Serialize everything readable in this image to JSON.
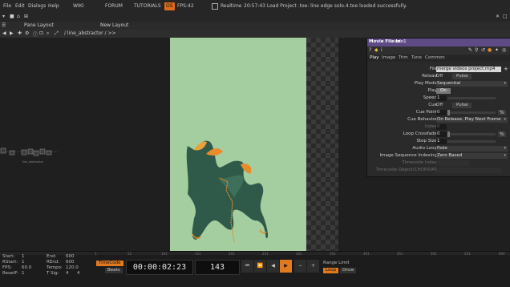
{
  "menu": {
    "file": "File",
    "edit": "Edit",
    "dialogs": "Dialogs",
    "help": "Help",
    "wiki": "WIKI",
    "forum": "FORUM",
    "tutorials": "TUTORIALS",
    "fps_label": "FPS:",
    "fps_value": "42",
    "realtime": "Realtime",
    "status": "20:57:43 Load Project .toe: line edge solo.4.toe loaded successfully.",
    "badge": "OS"
  },
  "panebar": {
    "pane_layout": "Pane Layout",
    "new_layout": "New Layout"
  },
  "pathbar": {
    "path": "/ line_abstractor / >>"
  },
  "network": {
    "node_label": "line_abstractor"
  },
  "param": {
    "title": "Movie File In",
    "node_name": "solo1",
    "tabs": [
      "Play",
      "Image",
      "Trim",
      "Tune",
      "Common"
    ],
    "file_label": "File",
    "file_value": "merge videos project.mp4",
    "reload_label": "Reload",
    "reload_off": "Off",
    "reload_pulse": "Pulse",
    "playmode_label": "Play Mode",
    "playmode_value": "Sequential",
    "play_label": "Play",
    "play_value": "On",
    "speed_label": "Speed",
    "speed_value": "1",
    "cue_label": "Cue",
    "cue_off": "Off",
    "cue_pulse": "Pulse",
    "cuepoint_label": "Cue Point",
    "cuepoint_value": "0",
    "cuepoint_unit": "%",
    "cuebehavior_label": "Cue Behavior",
    "cuebehavior_value": "On Release, Play Next Frame",
    "index_label": "Index",
    "index_value": "0",
    "loopcross_label": "Loop Crossfade",
    "loopcross_value": "0",
    "loopcross_unit": "%",
    "stepsize_label": "Step Size",
    "stepsize_value": "1",
    "audioloop_label": "Audio Loop",
    "audioloop_value": "Fade",
    "imgseq_label": "Image Sequence Indexing",
    "imgseq_value": "Zero Based",
    "timecode_label": "Timecode Index",
    "timecodeobj_label": "Timecode Object/CHOP/DAT"
  },
  "ruler": {
    "ticks": [
      "1",
      "51",
      "101",
      "151",
      "201",
      "251",
      "301",
      "351",
      "401",
      "451",
      "501",
      "551",
      "600"
    ]
  },
  "stats": {
    "start_label": "Start:",
    "start": "1",
    "end_label": "End:",
    "end": "600",
    "rstart_label": "RStart:",
    "rstart": "1",
    "rend_label": "REnd:",
    "rend": "600",
    "fps_label": "FPS:",
    "fps": "60.0",
    "tempo_label": "Tempo:",
    "tempo": "120.0",
    "resetf_label": "ResetF:",
    "resetf": "1",
    "tsig_label": "T Sig:",
    "tsig_a": "4",
    "tsig_b": "4"
  },
  "transport": {
    "timecode_btn": "TimeCode",
    "beats_btn": "Beats",
    "timecode": "00:00:02:23",
    "frame": "143",
    "range_limit": "Range Limit",
    "loop": "Loop",
    "once": "Once",
    "buttons": [
      "⏮",
      "⏪",
      "◀",
      "▶",
      "−",
      "+",
      "⏭"
    ]
  },
  "colors": {
    "viewer_bg": "#a4ce9f",
    "accent_orange": "#e07a1e",
    "param_title": "#5e4b86"
  }
}
